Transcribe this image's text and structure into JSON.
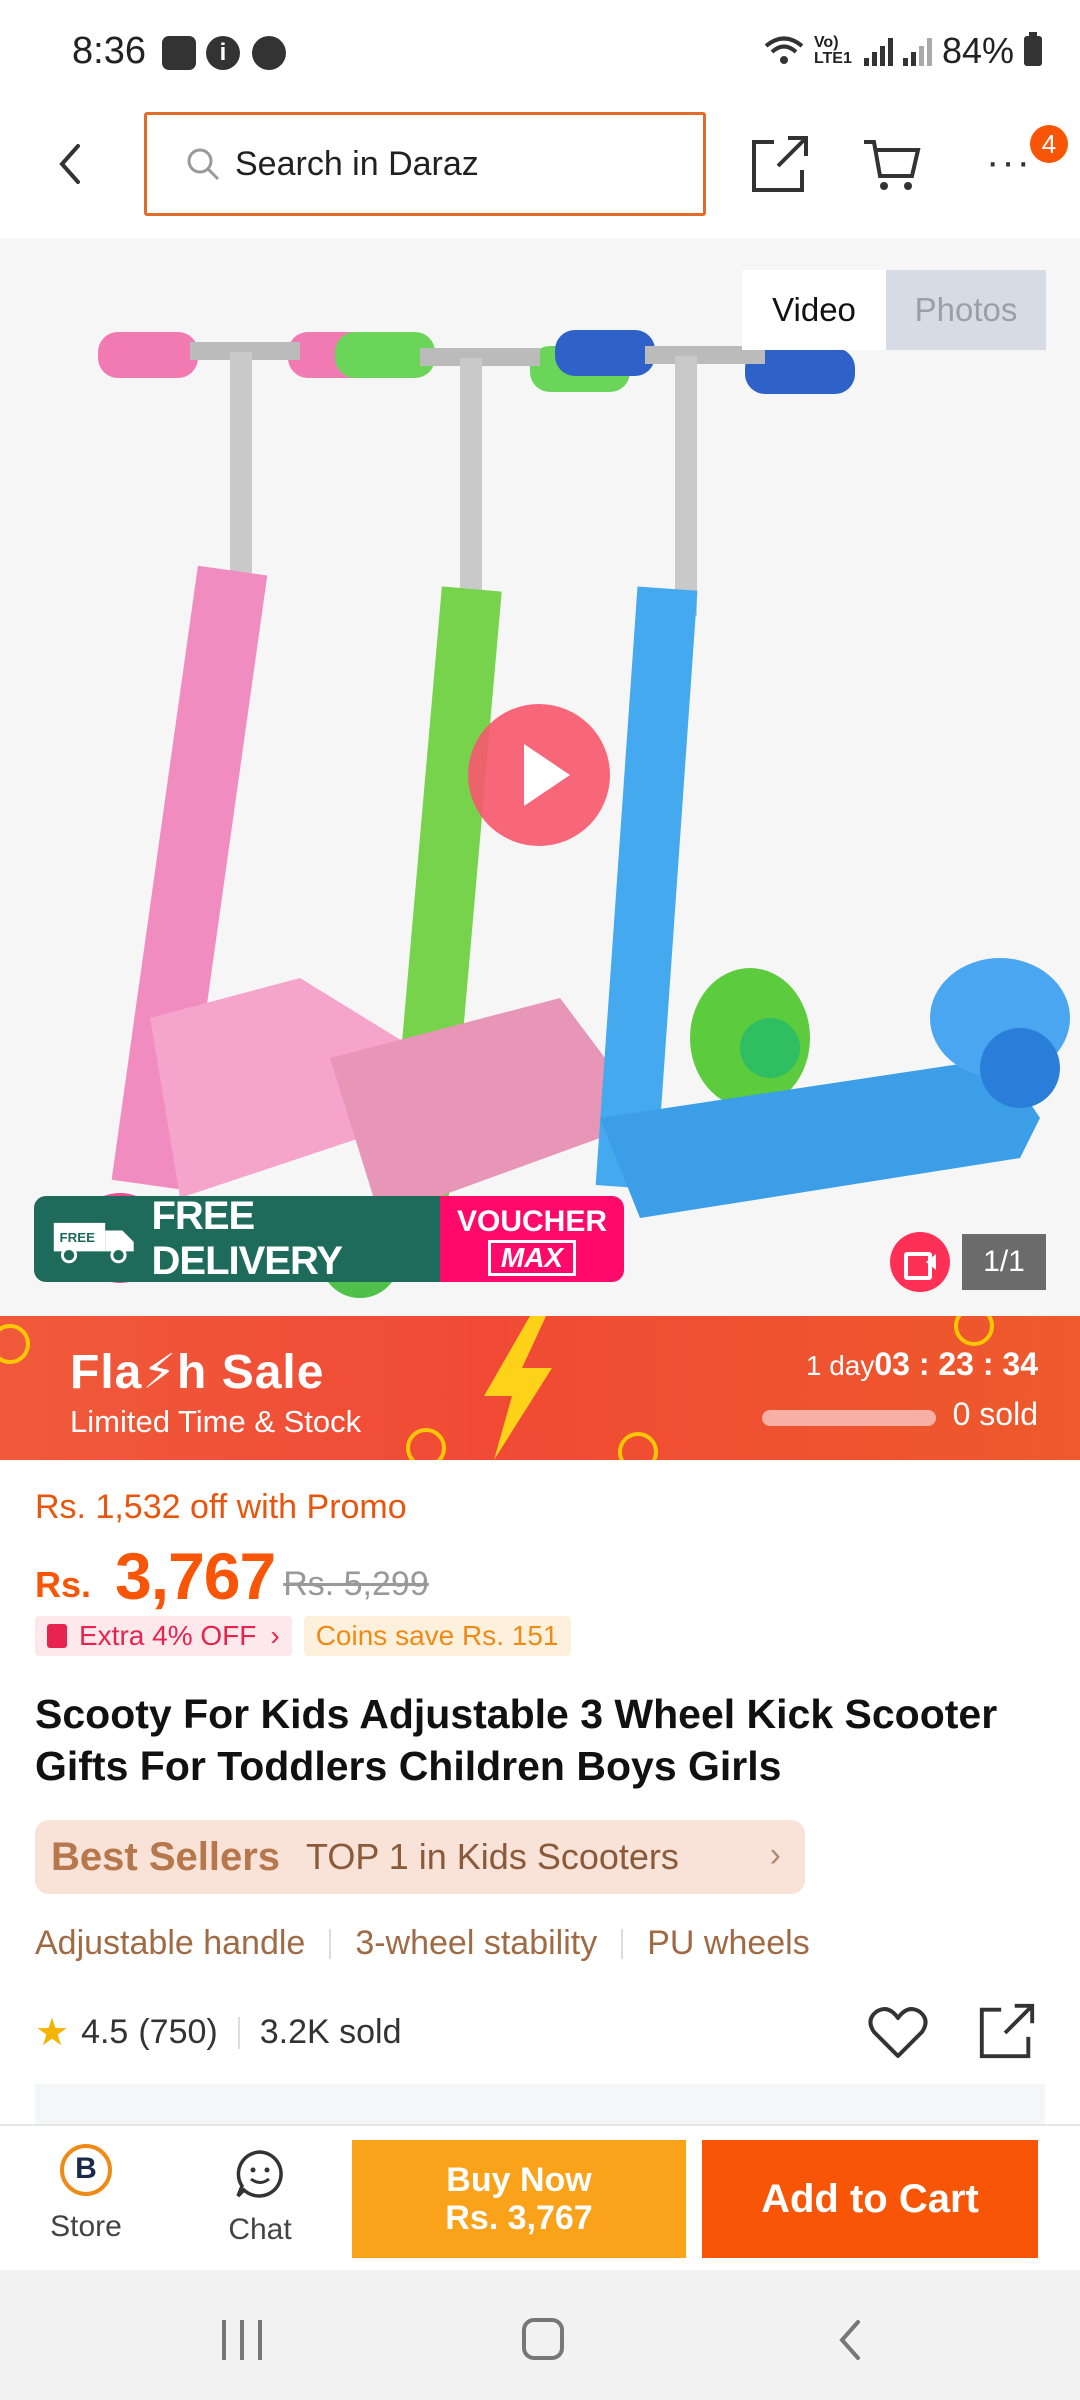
{
  "status_bar": {
    "time": "8:36",
    "network": "Vo) LTE1",
    "battery": "84%"
  },
  "header": {
    "search_placeholder": "Search in Daraz",
    "cart_badge": "4"
  },
  "gallery": {
    "tabs": {
      "video": "Video",
      "photos": "Photos"
    },
    "active_tab": "Video",
    "free_delivery": "FREE DELIVERY",
    "free_tag": "FREE",
    "voucher_line1": "VOUCHER",
    "voucher_line2": "MAX",
    "counter": "1/1"
  },
  "flash_sale": {
    "title": "Fla⚡h Sale",
    "subtitle": "Limited Time & Stock",
    "days": "1 day",
    "countdown": "03 : 23 : 34",
    "progress": 0.0,
    "sold": "0 sold"
  },
  "pricing": {
    "promo": "Rs. 1,532 off with Promo",
    "currency": "Rs.",
    "price": "3,767",
    "original_price": "Rs. 5,299",
    "extra_off": "Extra 4% OFF",
    "coins": "Coins save Rs. 151"
  },
  "product": {
    "title": "Scooty For Kids Adjustable 3 Wheel Kick Scooter Gifts For Toddlers Children Boys Girls",
    "best_sellers_label": "Best Sellers",
    "best_sellers_rank": "TOP 1 in Kids Scooters",
    "features": [
      "Adjustable handle",
      "3-wheel stability",
      "PU wheels"
    ],
    "rating": "4.5",
    "reviews": "(750)",
    "sold": "3.2K sold"
  },
  "bottom_bar": {
    "store_label": "Store",
    "chat_label": "Chat",
    "buy_now_line1": "Buy Now",
    "buy_now_line2": "Rs. 3,767",
    "add_to_cart": "Add to Cart"
  },
  "colors": {
    "brand_orange": "#f85606",
    "buy_now": "#faa21a",
    "free_delivery_green": "#1f6b5b",
    "voucher_pink": "#ff0a6a"
  }
}
